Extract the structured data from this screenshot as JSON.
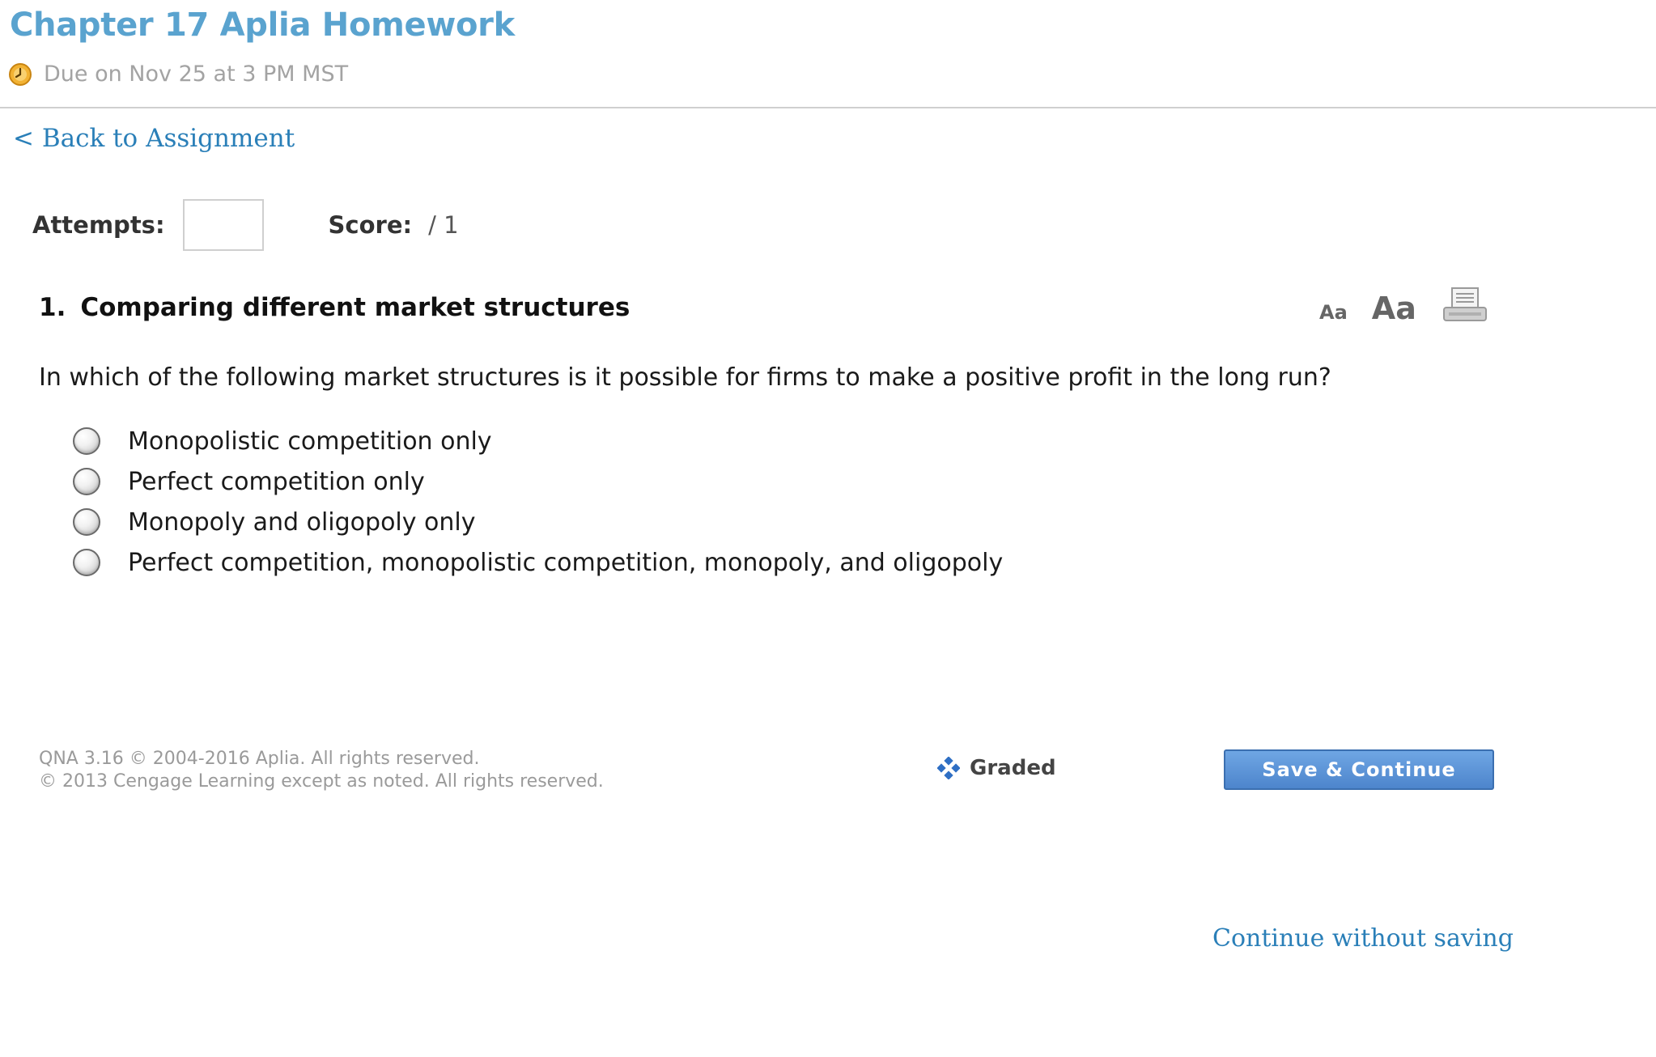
{
  "header": {
    "title": "Chapter 17 Aplia Homework",
    "due": "Due on Nov 25 at 3 PM MST"
  },
  "nav": {
    "back_link": "< Back to Assignment"
  },
  "status": {
    "attempts_label": "Attempts:",
    "attempts_value": "",
    "score_label": "Score:",
    "score_value": "/ 1"
  },
  "question": {
    "number": "1.",
    "title": "Comparing different market structures",
    "prompt": "In which of the following market structures is it possible for firms to make a positive profit in the long run?",
    "options": [
      "Monopolistic competition only",
      "Perfect competition only",
      "Monopoly and oligopoly only",
      "Perfect competition, monopolistic competition, monopoly, and oligopoly"
    ]
  },
  "tools": {
    "font_small": "Aa",
    "font_large": "Aa",
    "print_icon": "printer-icon"
  },
  "footer": {
    "copyright_line1": "QNA 3.16 © 2004-2016 Aplia. All rights reserved.",
    "copyright_line2": "© 2013 Cengage Learning except as noted. All rights reserved.",
    "graded_label": "Graded",
    "save_button": "Save & Continue",
    "continue_link": "Continue without saving"
  },
  "colors": {
    "title": "#5aa3cf",
    "link": "#2a7fb8",
    "button": "#5a90d4",
    "graded_icon": "#2f6fc4",
    "clock_icon": "#e8a21a"
  }
}
